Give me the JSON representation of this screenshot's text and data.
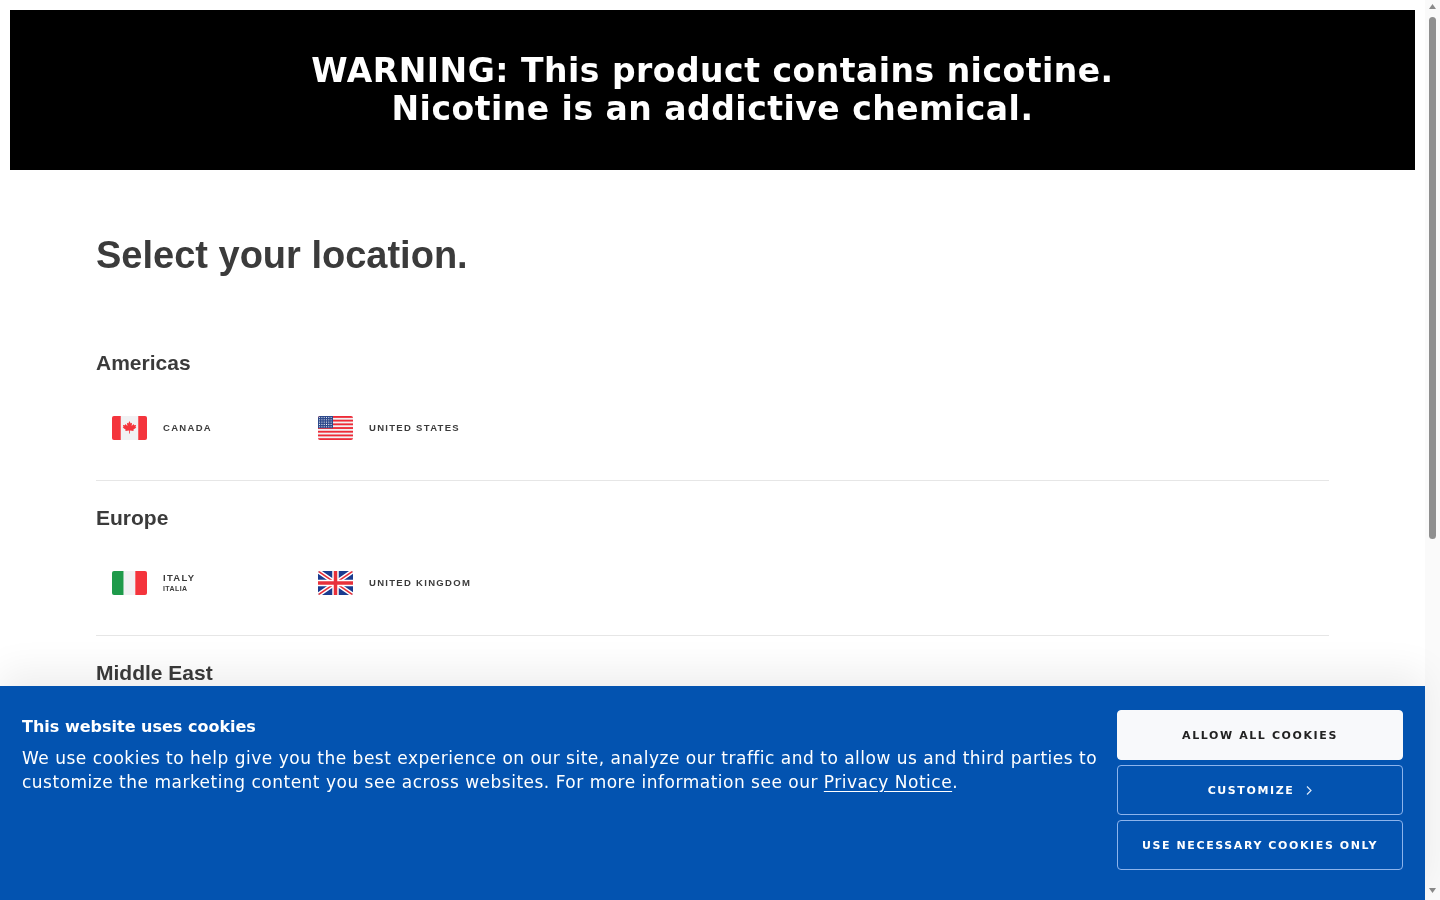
{
  "warning": {
    "lines": [
      "WARNING: This product contains nicotine.",
      "Nicotine is an addictive chemical."
    ]
  },
  "heading": "Select your location.",
  "regions": [
    {
      "name": "Americas",
      "countries": [
        {
          "kind": "canada",
          "name": "CANADA"
        },
        {
          "kind": "usa",
          "name": "UNITED STATES"
        }
      ]
    },
    {
      "name": "Europe",
      "countries": [
        {
          "kind": "italy",
          "name": "ITALY",
          "native_name": "ITALIA"
        },
        {
          "kind": "uk",
          "name": "UNITED KINGDOM"
        }
      ]
    },
    {
      "name": "Middle East"
    }
  ],
  "cookie_banner": {
    "title": "This website uses cookies",
    "text_before": "We use cookies to help give you the best experience on our site, analyze our traffic and to allow us and third parties to customize the marketing content you see across websites. For more information see our",
    "link": "Privacy Notice",
    "text_after": ".",
    "buttons": [
      {
        "kind": "solid",
        "label": "ALLOW ALL COOKIES"
      },
      {
        "kind": "forward",
        "label": "CUSTOMIZE"
      },
      {
        "kind": "outline",
        "label": "USE NECESSARY COOKIES ONLY"
      }
    ]
  }
}
